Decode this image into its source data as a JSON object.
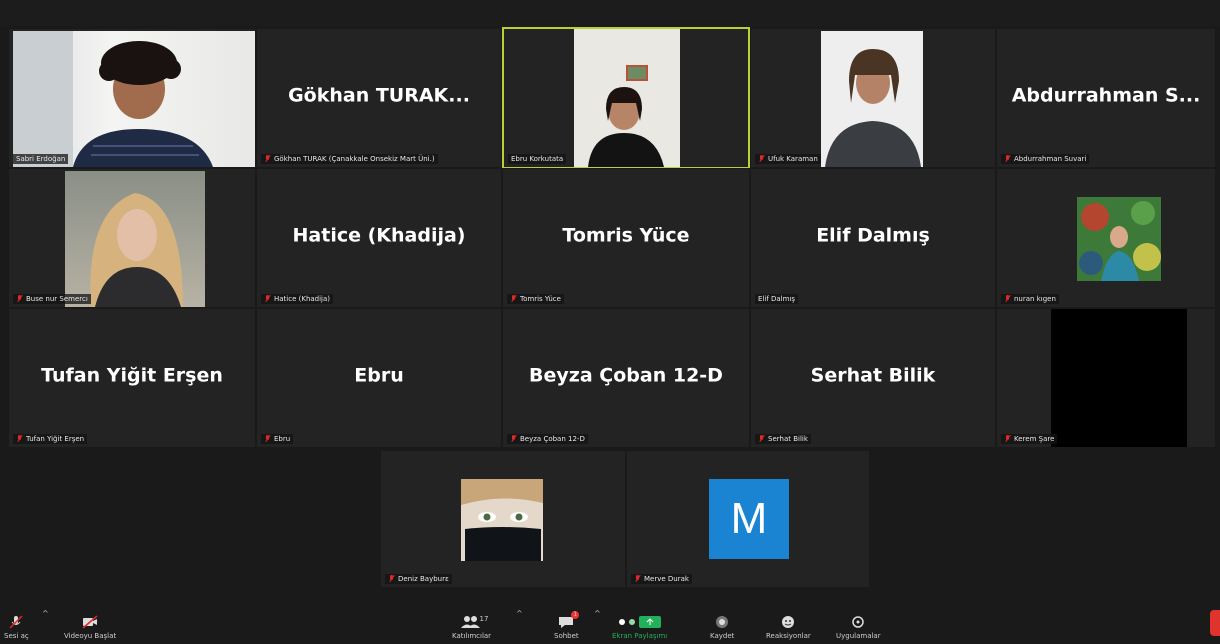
{
  "participants": [
    {
      "id": "p1",
      "big": "",
      "label": "Sabri Erdoğan",
      "muted": false,
      "video": "person1"
    },
    {
      "id": "p2",
      "big": "Gökhan  TURAK...",
      "label": "Gökhan TURAK (Çanakkale Onsekiz Mart Üni.)",
      "muted": true
    },
    {
      "id": "p3",
      "big": "",
      "label": "Ebru Korkutata",
      "muted": false,
      "video": "person2",
      "active": true
    },
    {
      "id": "p4",
      "big": "",
      "label": "Ufuk Karaman",
      "muted": true,
      "video": "person3"
    },
    {
      "id": "p5",
      "big": "Abdurrahman  S...",
      "label": "Abdurrahman Suvari",
      "muted": true
    },
    {
      "id": "p6",
      "big": "",
      "label": "Buse nur Semercı",
      "muted": true,
      "video": "person4"
    },
    {
      "id": "p7",
      "big": "Hatice (Khadija)",
      "label": "Hatice (Khadija)",
      "muted": true
    },
    {
      "id": "p8",
      "big": "Tomris Yüce",
      "label": "Tomris Yüce",
      "muted": true
    },
    {
      "id": "p9",
      "big": "Elif Dalmış",
      "label": "Elif Dalmış",
      "muted": false
    },
    {
      "id": "p10",
      "big": "",
      "label": "nuran kıgen",
      "muted": true,
      "video": "person5"
    },
    {
      "id": "p11",
      "big": "Tufan Yiğit Erşen",
      "label": "Tufan Yiğit Erşen",
      "muted": true
    },
    {
      "id": "p12",
      "big": "Ebru",
      "label": "Ebru",
      "muted": true
    },
    {
      "id": "p13",
      "big": "Beyza Çoban 12-D",
      "label": "Beyza Çoban 12-D",
      "muted": true
    },
    {
      "id": "p14",
      "big": "Serhat Bilik",
      "label": "Serhat Bilik",
      "muted": true
    },
    {
      "id": "p15",
      "big": "",
      "label": "Kerem Şare",
      "muted": true,
      "video": "black"
    },
    {
      "id": "p16",
      "big": "",
      "label": "Deniz Bayburε",
      "muted": true,
      "video": "person6"
    },
    {
      "id": "p17",
      "big": "",
      "label": "Merve Durak",
      "muted": true,
      "video": "avatar"
    }
  ],
  "avatar_letter": "M",
  "toolbar": {
    "mute_label": "Sesi aç",
    "video_label": "Videoyu Başlat",
    "participants_label": "Katılımcılar",
    "participants_count": "17",
    "chat_label": "Sohbet",
    "chat_badge": "1",
    "share_label": "Ekran Paylaşımı",
    "record_label": "Kaydet",
    "reactions_label": "Reaksiyonlar",
    "apps_label": "Uygulamalar"
  },
  "colors": {
    "active_border": "#b5d334",
    "muted_icon": "#e02828",
    "share_green": "#23b05a",
    "avatar_bg": "#1b84d2",
    "end": "#e0332e"
  }
}
